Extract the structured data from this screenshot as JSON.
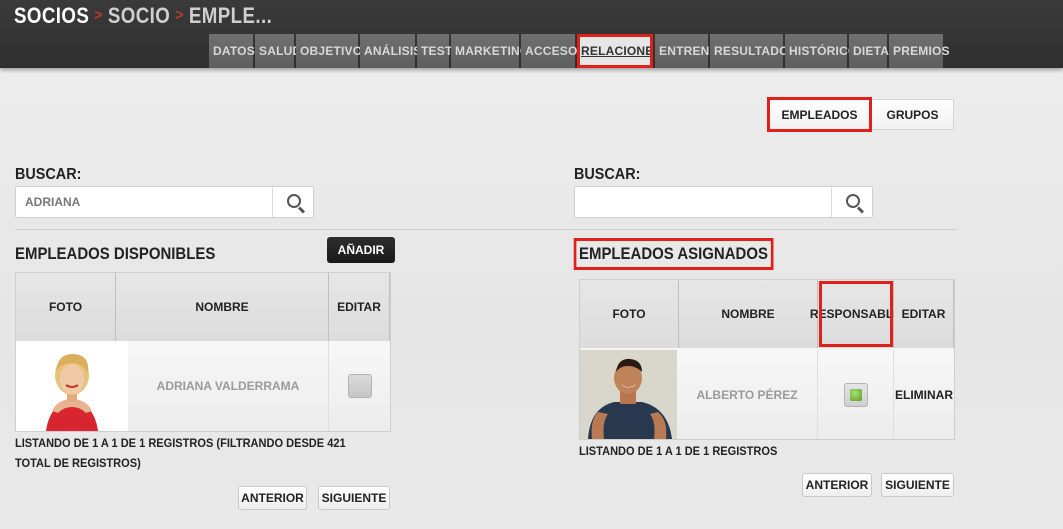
{
  "breadcrumb": {
    "part1": "SOCIOS",
    "part2": "SOCIO",
    "part3": "EMPLE...",
    "sep": ">"
  },
  "tabs": [
    {
      "label": "DATOS"
    },
    {
      "label": "SALUD"
    },
    {
      "label": "OBJETIVOS"
    },
    {
      "label": "ANÁLISIS"
    },
    {
      "label": "TEST"
    },
    {
      "label": "MARKETING"
    },
    {
      "label": "ACCESOS"
    },
    {
      "label": "RELACIONES"
    },
    {
      "label": "ENTRENO"
    },
    {
      "label": "RESULTADOS"
    },
    {
      "label": "HISTÓRICO"
    },
    {
      "label": "DIETA"
    },
    {
      "label": "PREMIOS"
    }
  ],
  "segments": {
    "employees": "EMPLEADOS",
    "groups": "GRUPOS"
  },
  "left": {
    "search_label": "BUSCAR:",
    "search_value": "ADRIANA",
    "title": "EMPLEADOS DISPONIBLES",
    "add_button": "AÑADIR",
    "columns": {
      "photo": "FOTO",
      "name": "NOMBRE",
      "edit": "EDITAR"
    },
    "rows": [
      {
        "name": "ADRIANA VALDERRAMA"
      }
    ],
    "info": "LISTANDO DE 1 A 1 DE 1 REGISTROS (FILTRANDO DESDE 421 TOTAL DE REGISTROS)",
    "prev": "ANTERIOR",
    "next": "SIGUIENTE"
  },
  "right": {
    "search_label": "BUSCAR:",
    "search_value": "",
    "title": "EMPLEADOS ASIGNADOS",
    "columns": {
      "photo": "FOTO",
      "name": "NOMBRE",
      "responsible": "RESPONSABLE",
      "edit": "EDITAR"
    },
    "rows": [
      {
        "name": "ALBERTO PÉREZ",
        "action": "ELIMINAR"
      }
    ],
    "info": "LISTANDO DE 1 A 1 DE 1 REGISTROS",
    "prev": "ANTERIOR",
    "next": "SIGUIENTE"
  },
  "colors": {
    "highlight": "#e0201b",
    "header_bg": "#333333",
    "separator": "#c0392b"
  }
}
